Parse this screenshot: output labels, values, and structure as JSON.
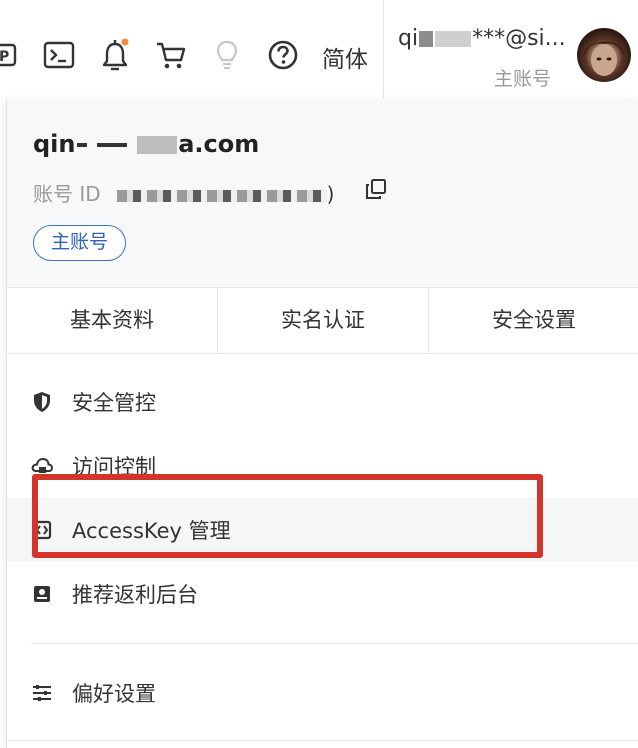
{
  "topbar": {
    "icons": [
      "ticket-icon",
      "terminal-icon",
      "bell-icon",
      "cart-icon",
      "lightbulb-icon",
      "help-icon"
    ],
    "notification_dot_color": "#f08a3c",
    "language": "简体",
    "account_email": "qi***@si...",
    "account_email_prefix": "qi",
    "account_email_suffix": "***@si...",
    "account_role": "主账号"
  },
  "dropdown": {
    "email_start": "qin",
    "email_end": "a.com",
    "account_id_label": "账号 ID",
    "account_id_end": ")",
    "role_badge": "主账号",
    "tabs": [
      "基本资料",
      "实名认证",
      "安全设置"
    ],
    "menu": [
      {
        "label": "安全管控",
        "icon": "shield-icon"
      },
      {
        "label": "访问控制",
        "icon": "cloud-lock-icon"
      },
      {
        "label": "AccessKey 管理",
        "icon": "key-bracket-icon"
      },
      {
        "label": "推荐返利后台",
        "icon": "gift-card-icon"
      },
      {
        "label": "偏好设置",
        "icon": "sliders-icon"
      }
    ]
  },
  "colors": {
    "highlight_border": "#d3342b",
    "badge_blue": "#2f62b8"
  }
}
